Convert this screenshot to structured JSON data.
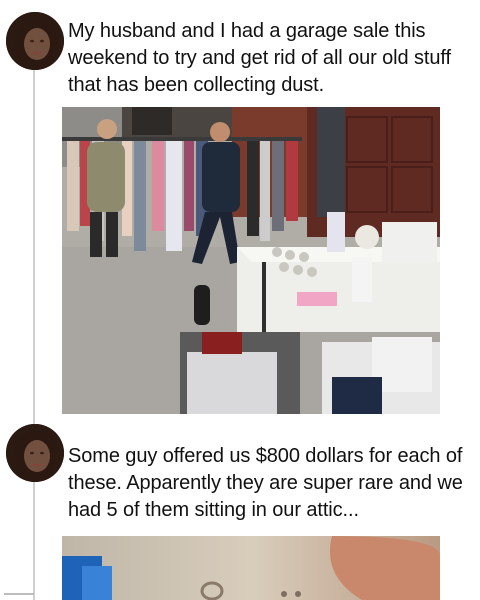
{
  "posts": [
    {
      "avatar_icon": "woman-portrait-avatar",
      "text": "My husband and I had a garage sale this weekend to try and get rid of all our old stuff that has been collecting dust.",
      "image": {
        "description_icon": "garage-sale-photo"
      }
    },
    {
      "avatar_icon": "woman-portrait-avatar",
      "text": "Some guy offered us $800 dollars for each of these. Apparently they are super rare and we had 5 of them sitting in our attic...",
      "image": {
        "description_icon": "ring-closeup-photo"
      }
    }
  ],
  "colors": {
    "thread_line": "#cfcfcf",
    "text": "#111111",
    "brick": "#7a3a2c",
    "garage_door": "#6a2f25",
    "pavement": "#a9a6a2"
  }
}
